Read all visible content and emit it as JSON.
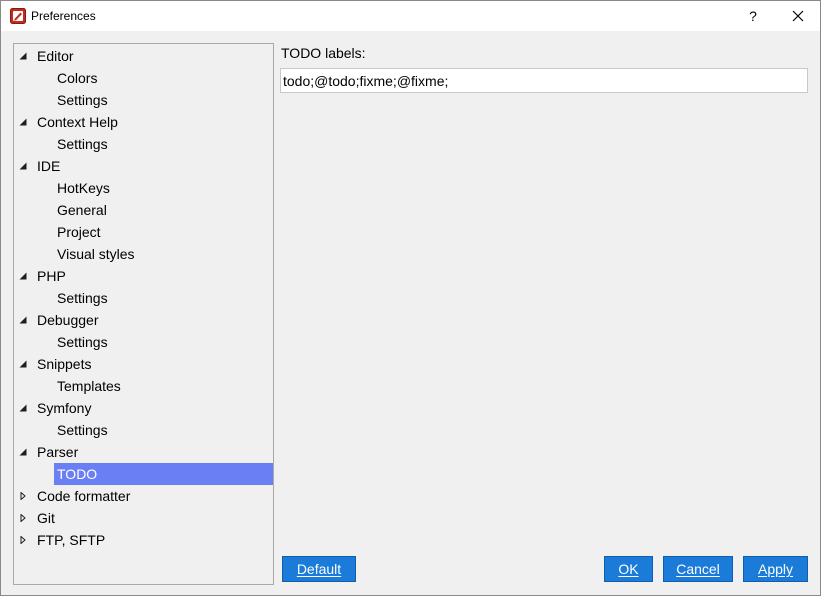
{
  "window": {
    "title": "Preferences",
    "help_label": "?"
  },
  "tree": {
    "items": [
      {
        "label": "Editor",
        "level": 0,
        "expanded": true
      },
      {
        "label": "Colors",
        "level": 1
      },
      {
        "label": "Settings",
        "level": 1
      },
      {
        "label": "Context Help",
        "level": 0,
        "expanded": true
      },
      {
        "label": "Settings",
        "level": 1
      },
      {
        "label": "IDE",
        "level": 0,
        "expanded": true
      },
      {
        "label": "HotKeys",
        "level": 1
      },
      {
        "label": "General",
        "level": 1
      },
      {
        "label": "Project",
        "level": 1
      },
      {
        "label": "Visual styles",
        "level": 1
      },
      {
        "label": "PHP",
        "level": 0,
        "expanded": true
      },
      {
        "label": "Settings",
        "level": 1
      },
      {
        "label": "Debugger",
        "level": 0,
        "expanded": true
      },
      {
        "label": "Settings",
        "level": 1
      },
      {
        "label": "Snippets",
        "level": 0,
        "expanded": true
      },
      {
        "label": "Templates",
        "level": 1
      },
      {
        "label": "Symfony",
        "level": 0,
        "expanded": true
      },
      {
        "label": "Settings",
        "level": 1
      },
      {
        "label": "Parser",
        "level": 0,
        "expanded": true
      },
      {
        "label": "TODO",
        "level": 1,
        "selected": true
      },
      {
        "label": "Code formatter",
        "level": 0,
        "expanded": false
      },
      {
        "label": "Git",
        "level": 0,
        "expanded": false
      },
      {
        "label": "FTP, SFTP",
        "level": 0,
        "expanded": false
      }
    ]
  },
  "panel": {
    "todo_label": "TODO labels:",
    "todo_value": "todo;@todo;fixme;@fixme;"
  },
  "buttons": {
    "default_label": "Default",
    "ok_label": "OK",
    "cancel_label": "Cancel",
    "apply_label": "Apply"
  },
  "colors": {
    "selection": "#6a7ff4",
    "button": "#1a7bd8",
    "app_icon": "#c42b1c"
  },
  "icons": {
    "app": "app-logo-icon",
    "close": "close-icon",
    "expanded": "triangle-down-icon",
    "collapsed": "triangle-right-icon"
  }
}
